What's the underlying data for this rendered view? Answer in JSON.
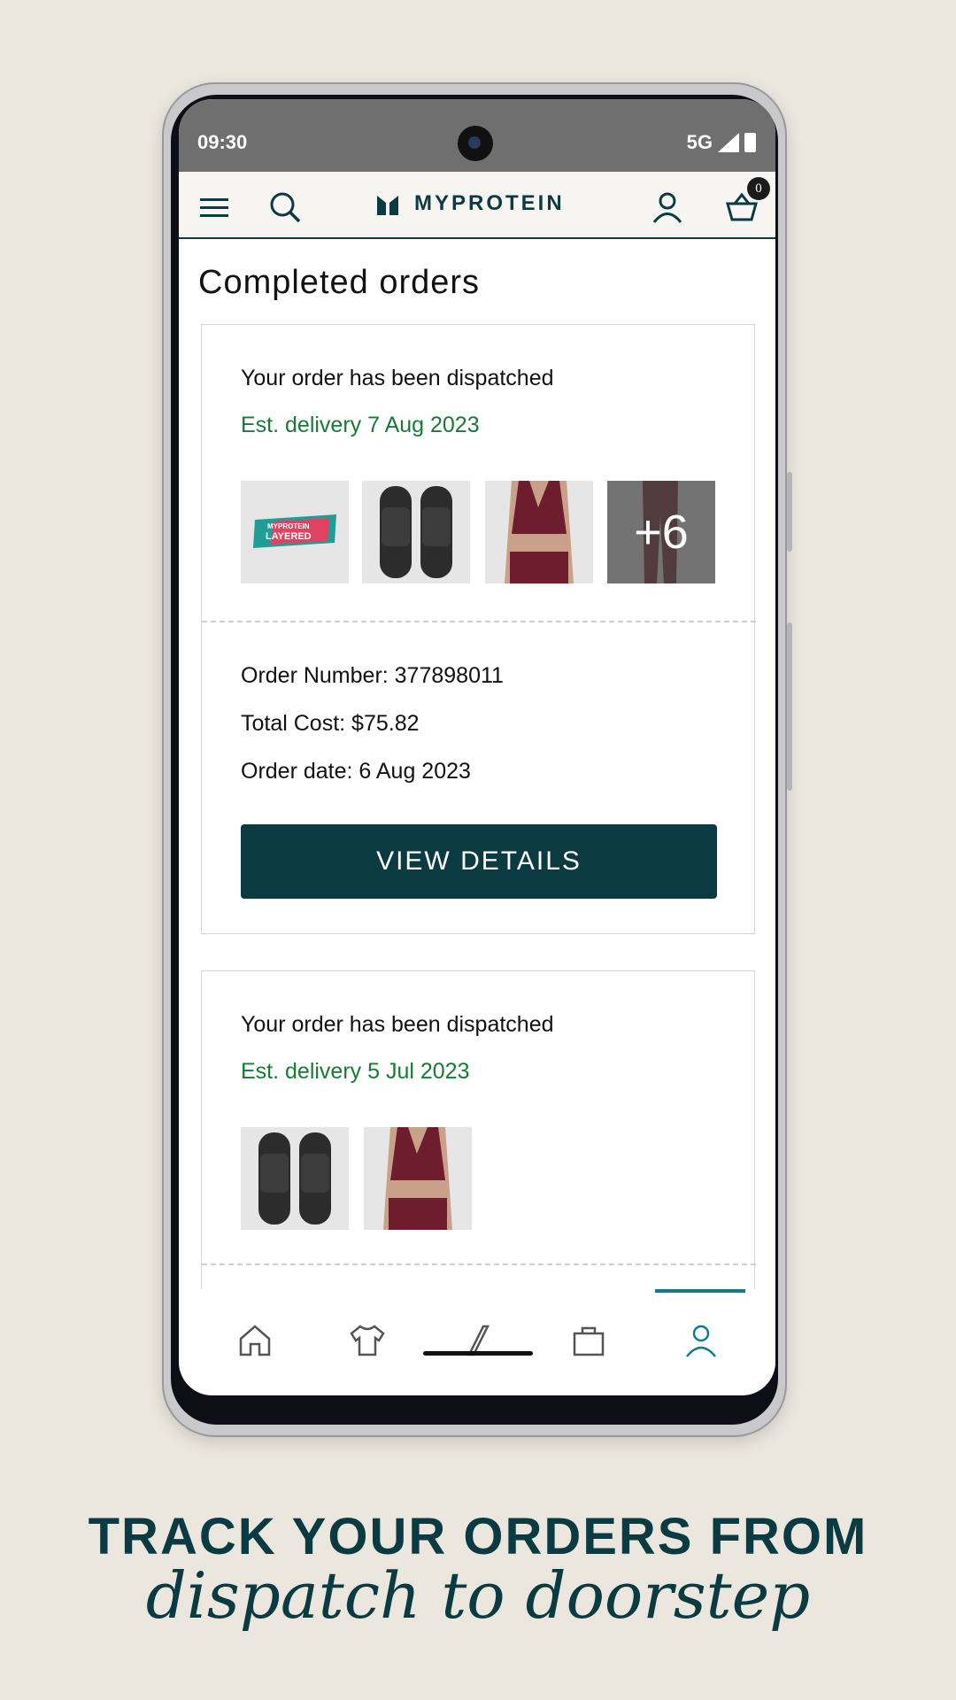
{
  "status_bar": {
    "time": "09:30",
    "network": "5G"
  },
  "header": {
    "brand": "MYPROTEIN",
    "basket_count": "0"
  },
  "page": {
    "title": "Completed orders"
  },
  "orders": [
    {
      "status": "Your order has been dispatched",
      "delivery": "Est. delivery 7 Aug 2023",
      "more_count": "+6",
      "order_number": "Order Number: 377898011",
      "total_cost": "Total Cost: $75.82",
      "order_date": "Order date: 6 Aug 2023",
      "button_label": "VIEW DETAILS"
    },
    {
      "status": "Your order has been dispatched",
      "delivery": "Est. delivery 5 Jul 2023"
    }
  ],
  "bar_label": "LAYERED",
  "bar_brand": "MYPROTEIN",
  "tagline": {
    "line1": "TRACK YOUR ORDERS FROM",
    "line2": "dispatch to doorstep"
  },
  "colors": {
    "brand": "#0b3b42",
    "delivery": "#177a36",
    "active_nav": "#117a8b"
  },
  "bottom_nav": [
    "home-icon",
    "tshirt-icon",
    "slash-icon",
    "bag-icon",
    "account-icon"
  ]
}
